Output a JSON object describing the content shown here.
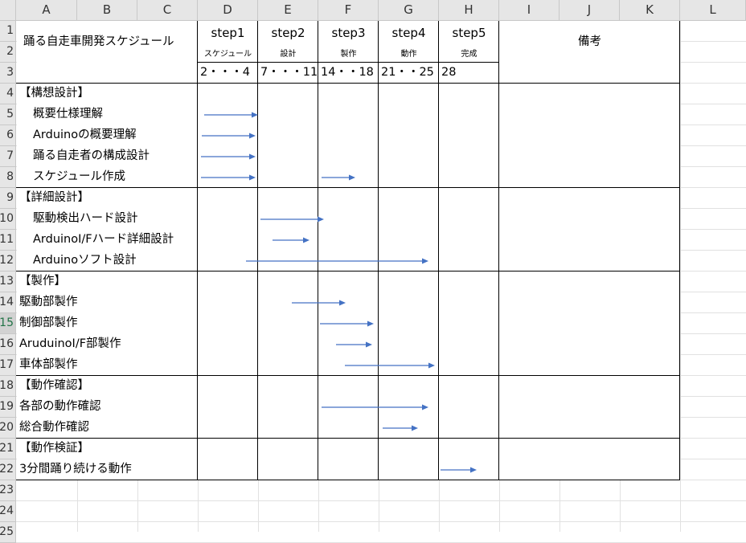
{
  "columns": [
    "A",
    "B",
    "C",
    "D",
    "E",
    "F",
    "G",
    "H",
    "I",
    "J",
    "K",
    "L"
  ],
  "rows": [
    "1",
    "2",
    "3",
    "4",
    "5",
    "6",
    "7",
    "8",
    "9",
    "10",
    "11",
    "12",
    "13",
    "14",
    "15",
    "16",
    "17",
    "18",
    "19",
    "20",
    "21",
    "22",
    "23",
    "24",
    "25"
  ],
  "selected_row": "15",
  "title": "踊る自走車開発スケジュール",
  "notes_header": "備考",
  "steps": [
    {
      "label": "step1",
      "sub": "スケジュール",
      "dates": "2・・・4"
    },
    {
      "label": "step2",
      "sub": "設計",
      "dates": "7・・・11"
    },
    {
      "label": "step3",
      "sub": "製作",
      "dates": "14・・18"
    },
    {
      "label": "step4",
      "sub": "動作",
      "dates": "21・・25"
    },
    {
      "label": "step5",
      "sub": "完成",
      "dates": "28"
    }
  ],
  "tasks": [
    {
      "row": "4",
      "text": "【構想設計】",
      "indent": false
    },
    {
      "row": "5",
      "text": "概要仕様理解",
      "indent": true
    },
    {
      "row": "6",
      "text": "Arduinoの概要理解",
      "indent": true
    },
    {
      "row": "7",
      "text": "踊る自走者の構成設計",
      "indent": true
    },
    {
      "row": "8",
      "text": "スケジュール作成",
      "indent": true
    },
    {
      "row": "9",
      "text": "【詳細設計】",
      "indent": false
    },
    {
      "row": "10",
      "text": "駆動検出ハード設計",
      "indent": true
    },
    {
      "row": "11",
      "text": "ArduinoI/Fハード詳細設計",
      "indent": true
    },
    {
      "row": "12",
      "text": "Arduinoソフト設計",
      "indent": true
    },
    {
      "row": "13",
      "text": "【製作】",
      "indent": false
    },
    {
      "row": "14",
      "text": "駆動部製作",
      "indent": false
    },
    {
      "row": "15",
      "text": "制御部製作",
      "indent": false
    },
    {
      "row": "16",
      "text": "AruduinoI/F部製作",
      "indent": false
    },
    {
      "row": "17",
      "text": "車体部製作",
      "indent": false
    },
    {
      "row": "18",
      "text": "【動作確認】",
      "indent": false
    },
    {
      "row": "19",
      "text": "各部の動作確認",
      "indent": false
    },
    {
      "row": "20",
      "text": "総合動作確認",
      "indent": false
    },
    {
      "row": "21",
      "text": "【動作検証】",
      "indent": false
    },
    {
      "row": "22",
      "text": "3分間踊り続ける動作",
      "indent": false
    }
  ],
  "arrow_color": "#4472c4",
  "header_bg": "#e6e6e6",
  "selected_text_color": "#217346"
}
